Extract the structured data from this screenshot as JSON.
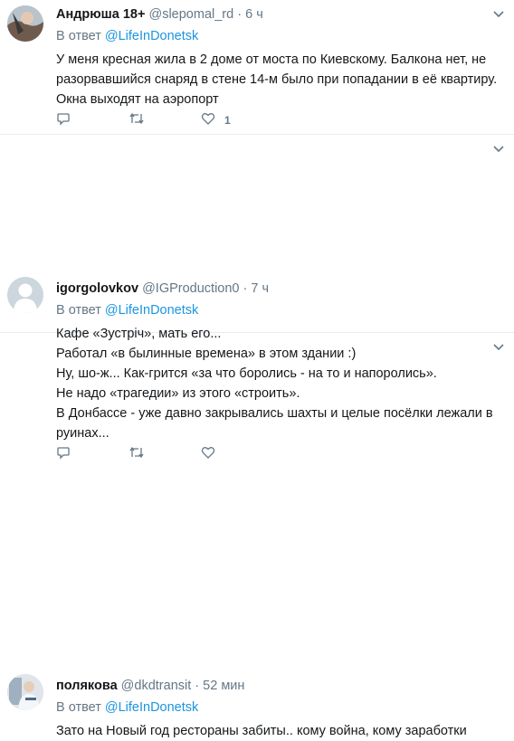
{
  "tweets": [
    {
      "name": "Андрюша 18+",
      "handle": "@slepomal_rd",
      "dot": "·",
      "time": "6 ч",
      "reply_prefix": "В ответ",
      "reply_to": "@LifeInDonetsk",
      "lines": [
        "У меня кресная жила в 2 доме от моста по Киевскому. Балкона нет, не",
        "разорвавшийся снаряд в стене 14-м было при попадании в её квартиру.",
        "Окна выходят на аэропорт"
      ],
      "likes": "1"
    },
    {
      "name": "igorgolovkov",
      "handle": "@IGProduction0",
      "dot": "·",
      "time": "7 ч",
      "reply_prefix": "В ответ",
      "reply_to": "@LifeInDonetsk",
      "lines": [
        "Кафе «Зустріч», мать его...",
        "Работал «в былинные времена» в этом здании :)",
        "Ну, шо-ж... Как-грится «за что боролись - на то и напоролись».",
        "Не надо «трагедии» из этого «строить».",
        "В Донбассе - уже давно закрывались шахты и целые посёлки лежали в",
        "руинах..."
      ]
    },
    {
      "name": "полякова",
      "handle": "@dkdtransit",
      "dot": "·",
      "time": "52 мин",
      "reply_prefix": "В ответ",
      "reply_to": "@LifeInDonetsk",
      "lines": [
        "Зато на Новый год рестораны забиты.. кому война, кому заработки"
      ]
    }
  ],
  "icons": {
    "reply": "reply-icon",
    "retweet": "retweet-icon",
    "like": "heart-icon",
    "more": "chevron-down-icon"
  },
  "colors": {
    "link": "#1b95e0",
    "secondary": "#657786",
    "divider": "#e6ecf0"
  }
}
